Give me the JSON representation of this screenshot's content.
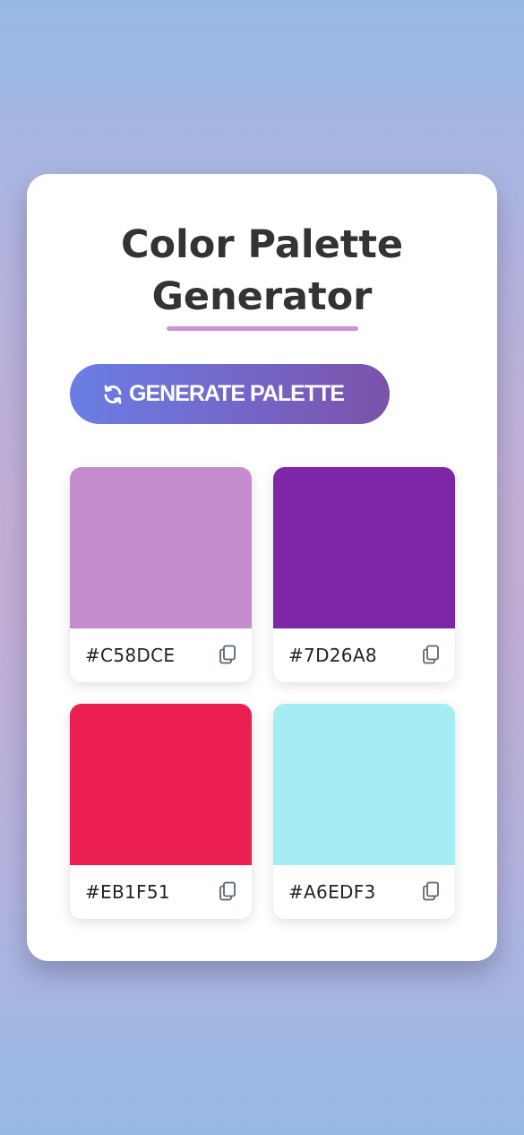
{
  "header": {
    "title_line1": "Color Palette",
    "title_line2": "Generator"
  },
  "generate_button": {
    "icon": "refresh-icon",
    "label": "GENERATE PALETTE"
  },
  "palette": [
    {
      "hex": "#C58DCE",
      "color": "#C58DCE",
      "copy_icon": "copy-icon"
    },
    {
      "hex": "#7D26A8",
      "color": "#7D26A8",
      "copy_icon": "copy-icon"
    },
    {
      "hex": "#EB1F51",
      "color": "#EB1F51",
      "copy_icon": "copy-icon"
    },
    {
      "hex": "#A6EDF3",
      "color": "#A6EDF3",
      "copy_icon": "copy-icon"
    }
  ],
  "colors": {
    "accent_underline": "#C995D2",
    "button_gradient_start": "#6A7EE3",
    "button_gradient_end": "#7B52A9",
    "title_text": "#333333"
  }
}
